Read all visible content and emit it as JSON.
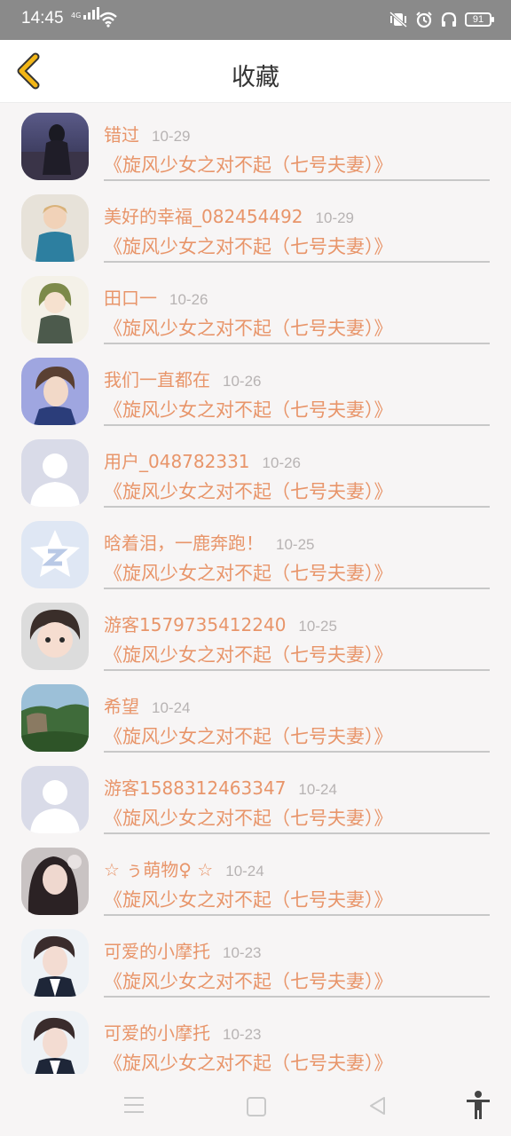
{
  "status": {
    "time": "14:45",
    "network": "4G",
    "battery": "91"
  },
  "header": {
    "title": "收藏"
  },
  "items": [
    {
      "name": "错过",
      "date": "10-29",
      "work": "《旋风少女之对不起（七号夫妻）》"
    },
    {
      "name": "美好的幸福_082454492",
      "date": "10-29",
      "work": "《旋风少女之对不起（七号夫妻）》"
    },
    {
      "name": "田口一",
      "date": "10-26",
      "work": "《旋风少女之对不起（七号夫妻）》"
    },
    {
      "name": "我们一直都在",
      "date": "10-26",
      "work": "《旋风少女之对不起（七号夫妻）》"
    },
    {
      "name": "用户_048782331",
      "date": "10-26",
      "work": "《旋风少女之对不起（七号夫妻）》"
    },
    {
      "name": "晗着泪，一鹿奔跑！",
      "date": "10-25",
      "work": "《旋风少女之对不起（七号夫妻）》"
    },
    {
      "name": "游客1579735412240",
      "date": "10-25",
      "work": "《旋风少女之对不起（七号夫妻）》"
    },
    {
      "name": "希望",
      "date": "10-24",
      "work": "《旋风少女之对不起（七号夫妻）》"
    },
    {
      "name": "游客1588312463347",
      "date": "10-24",
      "work": "《旋风少女之对不起（七号夫妻）》"
    },
    {
      "name": "☆ ぅ萌物♀ ☆",
      "date": "10-24",
      "work": "《旋风少女之对不起（七号夫妻）》"
    },
    {
      "name": "可爱的小摩托",
      "date": "10-23",
      "work": "《旋风少女之对不起（七号夫妻）》"
    },
    {
      "name": "可爱的小摩托",
      "date": "10-23",
      "work": "《旋风少女之对不起（七号夫妻）》"
    }
  ],
  "colors": {
    "accent": "#e8956a",
    "back_arrow": "#f2b617",
    "date": "#b7b3b3"
  }
}
